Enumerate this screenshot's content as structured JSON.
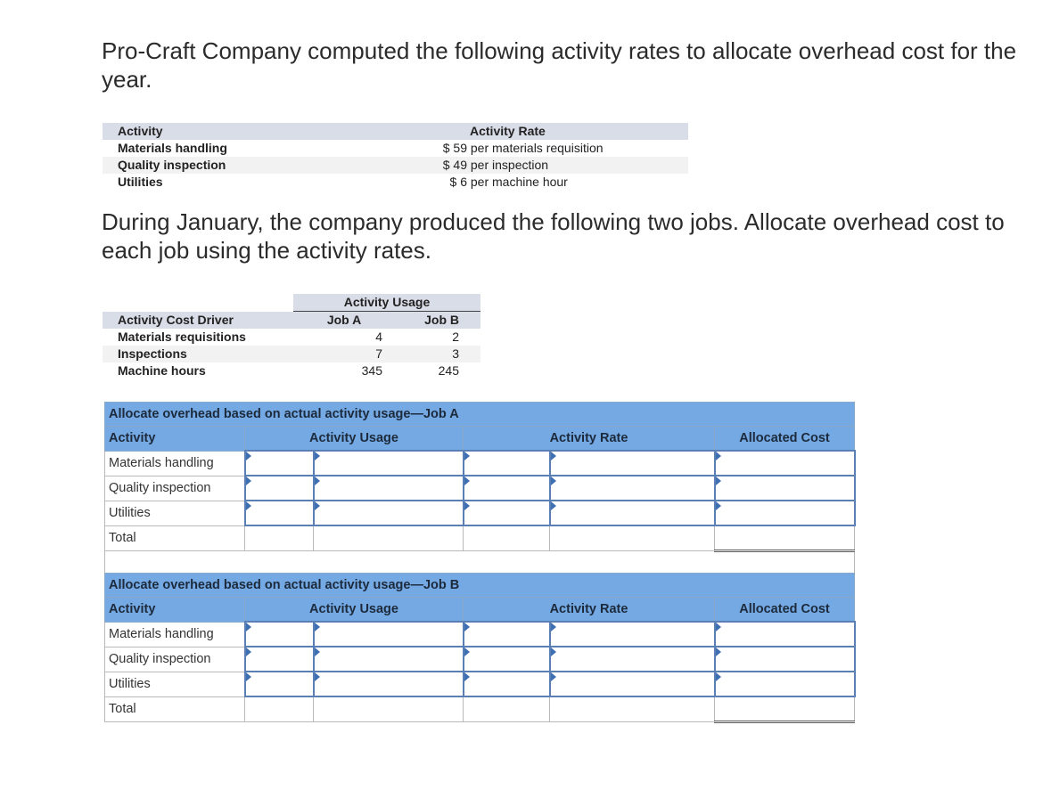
{
  "intro": {
    "paragraph1": "Pro-Craft Company computed the following activity rates to allocate overhead cost for the year.",
    "paragraph2": "During January, the company produced the following two jobs. Allocate overhead cost to each job using the activity rates."
  },
  "rate_table": {
    "headers": {
      "activity": "Activity",
      "rate": "Activity Rate"
    },
    "rows": [
      {
        "activity": "Materials handling",
        "amount": "$ 59",
        "unit": "per materials requisition"
      },
      {
        "activity": "Quality inspection",
        "amount": "$ 49",
        "unit": "per inspection"
      },
      {
        "activity": "Utilities",
        "amount": "$ 6",
        "unit": "per machine hour"
      }
    ]
  },
  "usage_table": {
    "group_header": "Activity Usage",
    "headers": {
      "driver": "Activity Cost Driver",
      "job_a": "Job A",
      "job_b": "Job B"
    },
    "rows": [
      {
        "driver": "Materials requisitions",
        "job_a": "4",
        "job_b": "2"
      },
      {
        "driver": "Inspections",
        "job_a": "7",
        "job_b": "3"
      },
      {
        "driver": "Machine hours",
        "job_a": "345",
        "job_b": "245"
      }
    ]
  },
  "worksheets": [
    {
      "title": "Allocate overhead based on actual activity usage—Job A",
      "columns": {
        "activity": "Activity",
        "usage": "Activity Usage",
        "rate": "Activity Rate",
        "cost": "Allocated Cost"
      },
      "rows": [
        "Materials handling",
        "Quality inspection",
        "Utilities"
      ],
      "total_label": "Total"
    },
    {
      "title": "Allocate overhead based on actual activity usage—Job B",
      "columns": {
        "activity": "Activity",
        "usage": "Activity Usage",
        "rate": "Activity Rate",
        "cost": "Allocated Cost"
      },
      "rows": [
        "Materials handling",
        "Quality inspection",
        "Utilities"
      ],
      "total_label": "Total"
    }
  ],
  "colors": {
    "header_blue": "#74a9e3",
    "input_border": "#5a7fb5",
    "table_header_gray": "#d9dde8"
  }
}
